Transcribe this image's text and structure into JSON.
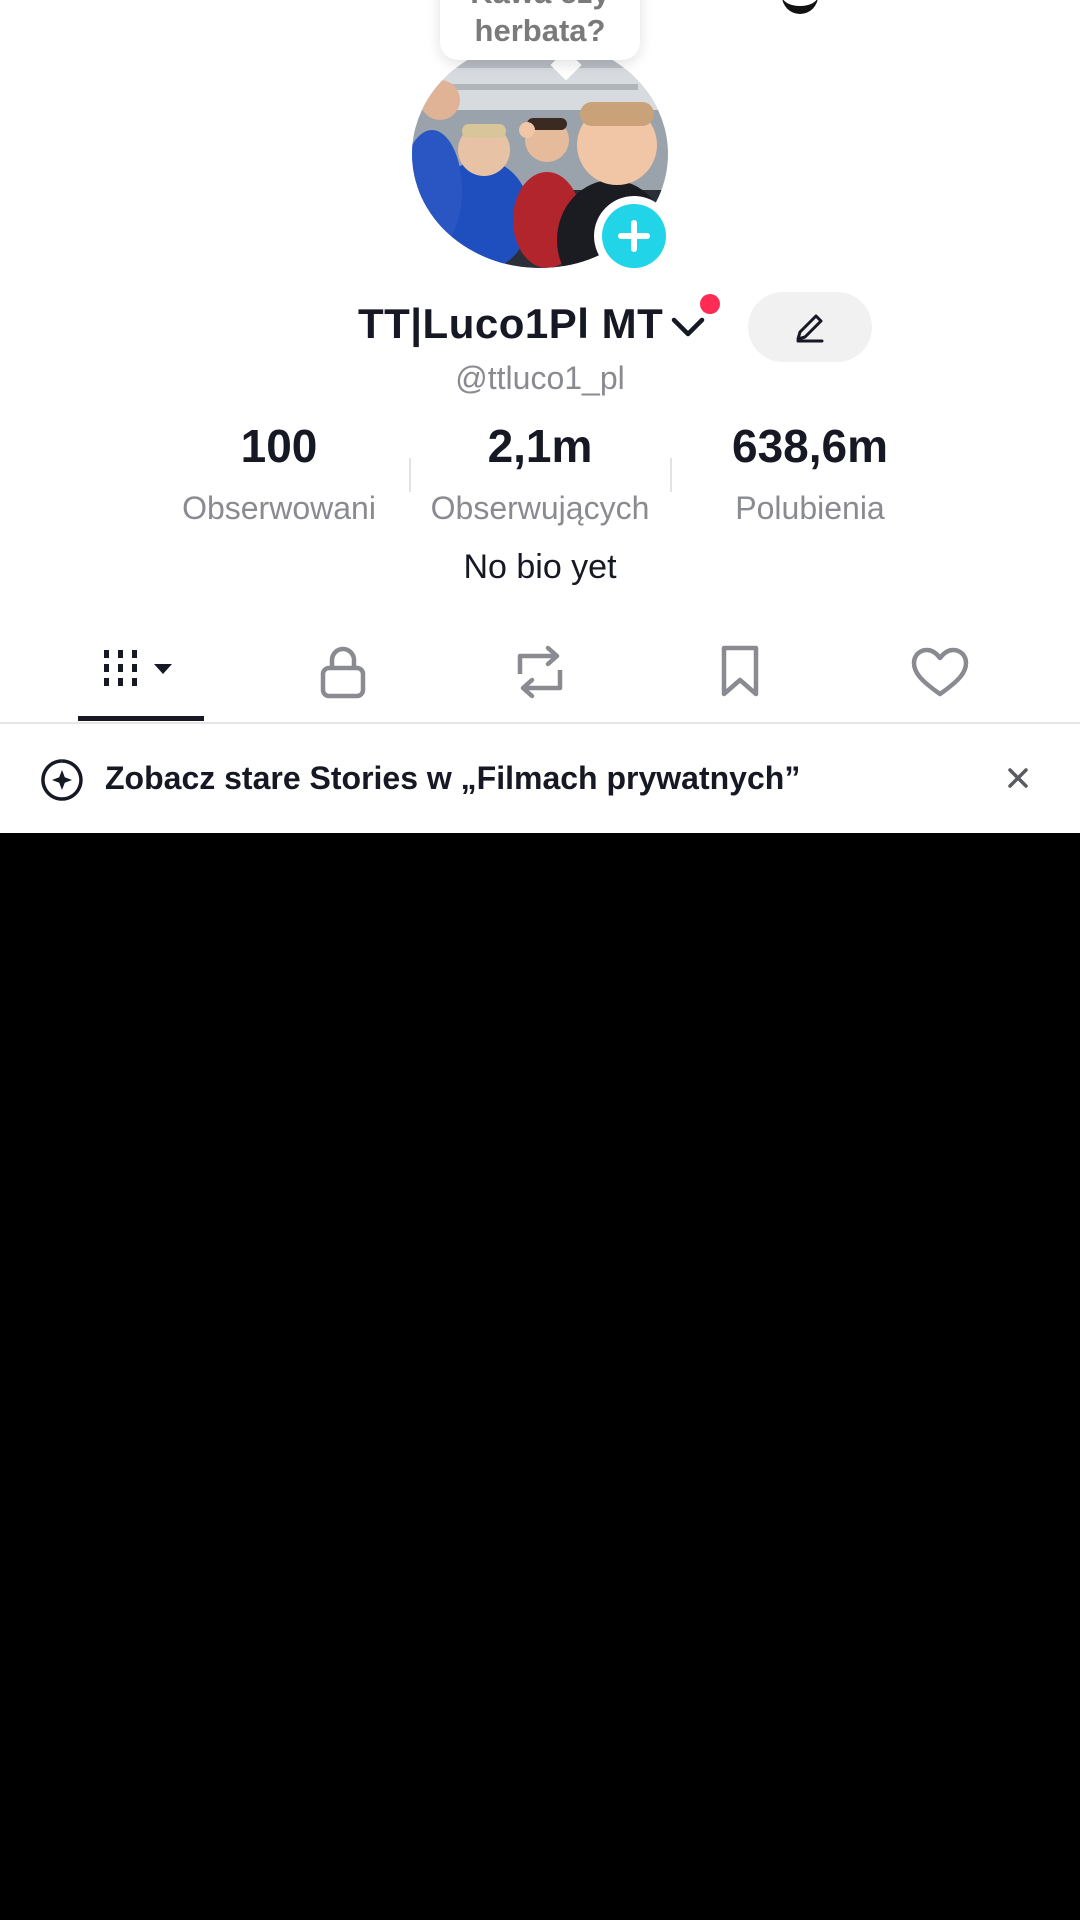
{
  "avatar_note": {
    "text": "Kawa czy\nherbata?"
  },
  "profile": {
    "display_name": "TT|Luco1Pl MT",
    "username": "@ttluco1_pl",
    "bio": "No bio yet",
    "has_notification": true
  },
  "stats": [
    {
      "value": "100",
      "label": "Obserwowani"
    },
    {
      "value": "2,1m",
      "label": "Obserwujących"
    },
    {
      "value": "638,6m",
      "label": "Polubienia"
    }
  ],
  "tabs": [
    {
      "id": "videos",
      "icon": "grid-icon",
      "selected": true
    },
    {
      "id": "private",
      "icon": "lock-icon",
      "selected": false
    },
    {
      "id": "reposts",
      "icon": "repost-icon",
      "selected": false
    },
    {
      "id": "favorites",
      "icon": "bookmark-icon",
      "selected": false
    },
    {
      "id": "liked",
      "icon": "heart-icon",
      "selected": false
    }
  ],
  "banner": {
    "text": "Zobacz stare Stories w „Filmach prywatnych”",
    "icon": "story-add-icon",
    "close_icon": "close-icon"
  },
  "colors": {
    "accent_cyan": "#22d4e8",
    "notification_red": "#fe2c55",
    "text_primary": "#161823",
    "text_secondary": "#8a8b91"
  }
}
